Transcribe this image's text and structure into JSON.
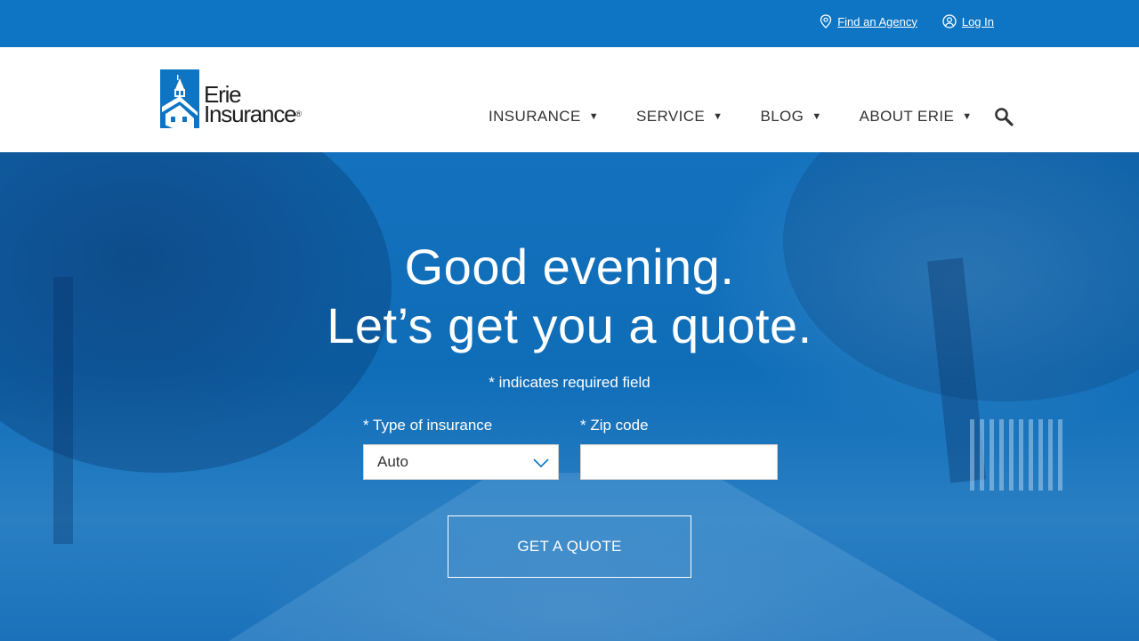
{
  "utility": {
    "find_agency": "Find an Agency",
    "login": "Log In"
  },
  "logo": {
    "line1": "Erie",
    "line2": "Insurance",
    "reg": "®"
  },
  "nav": {
    "items": [
      {
        "label": "INSURANCE",
        "icon": "caret-down-icon"
      },
      {
        "label": "SERVICE",
        "icon": "caret-down-icon"
      },
      {
        "label": "BLOG",
        "icon": "caret-down-icon"
      },
      {
        "label": "ABOUT ERIE",
        "icon": "caret-down-icon"
      }
    ],
    "search_icon": "search-icon"
  },
  "hero": {
    "headline_line1": "Good evening.",
    "headline_line2": "Let’s get you a quote.",
    "required_note": "* indicates required field",
    "type_label": "* Type of insurance",
    "type_value": "Auto",
    "zip_label": "* Zip code",
    "zip_value": "",
    "zip_placeholder": "",
    "cta_label": "GET A QUOTE"
  },
  "colors": {
    "brand_blue": "#0d75c4",
    "header_bg": "#ffffff",
    "text_dark": "#333333"
  }
}
